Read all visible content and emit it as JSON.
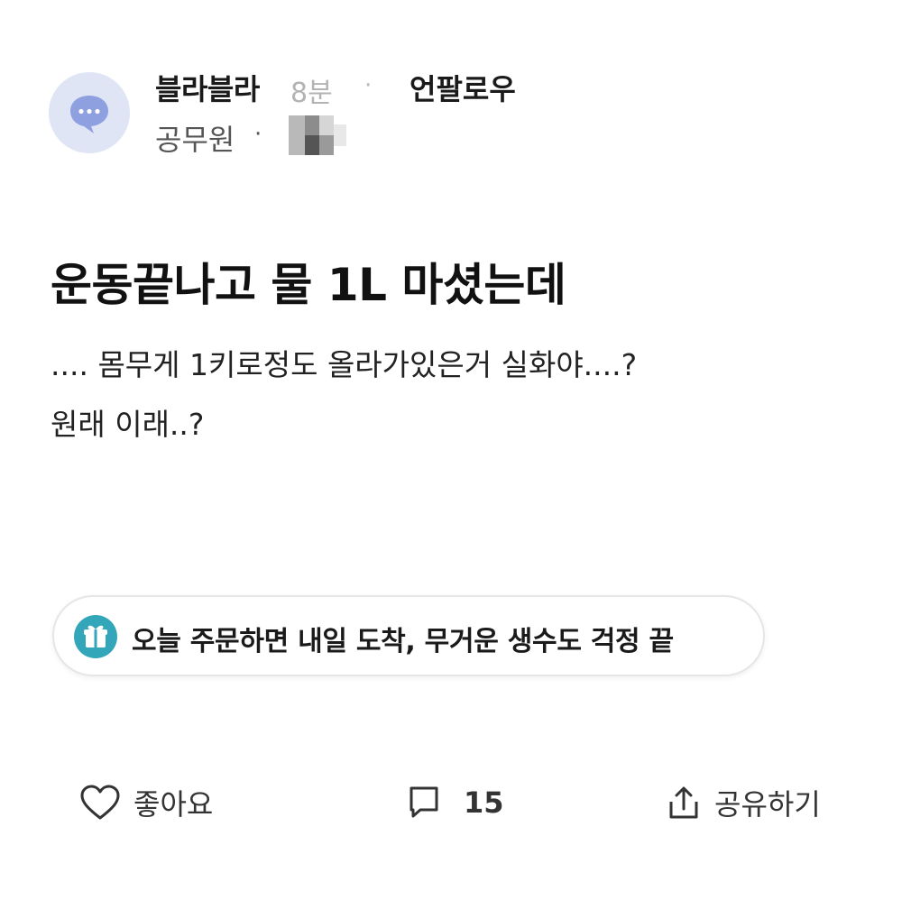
{
  "header": {
    "author_name": "블라블라",
    "post_time": "8분",
    "meta_separator": "·",
    "unfollow_label": "언팔로우",
    "job_label": "공무원"
  },
  "post": {
    "title": "운동끝나고 물 1L 마셨는데",
    "body_lines": [
      ".... 몸무게 1키로정도 올라가있은거 실화야....?",
      "원래 이래..?"
    ]
  },
  "ad": {
    "text": "오늘 주문하면 내일 도착, 무거운 생수도 걱정 끝",
    "icon": "gift-icon"
  },
  "actions": {
    "like_label": "좋아요",
    "comment_count": "15",
    "share_label": "공유하기"
  },
  "colors": {
    "avatar_bg": "#dfe5f5",
    "avatar_icon": "#8ea0e0",
    "ad_icon_bg": "#33a6b9",
    "muted_text": "#b3b3b3"
  }
}
